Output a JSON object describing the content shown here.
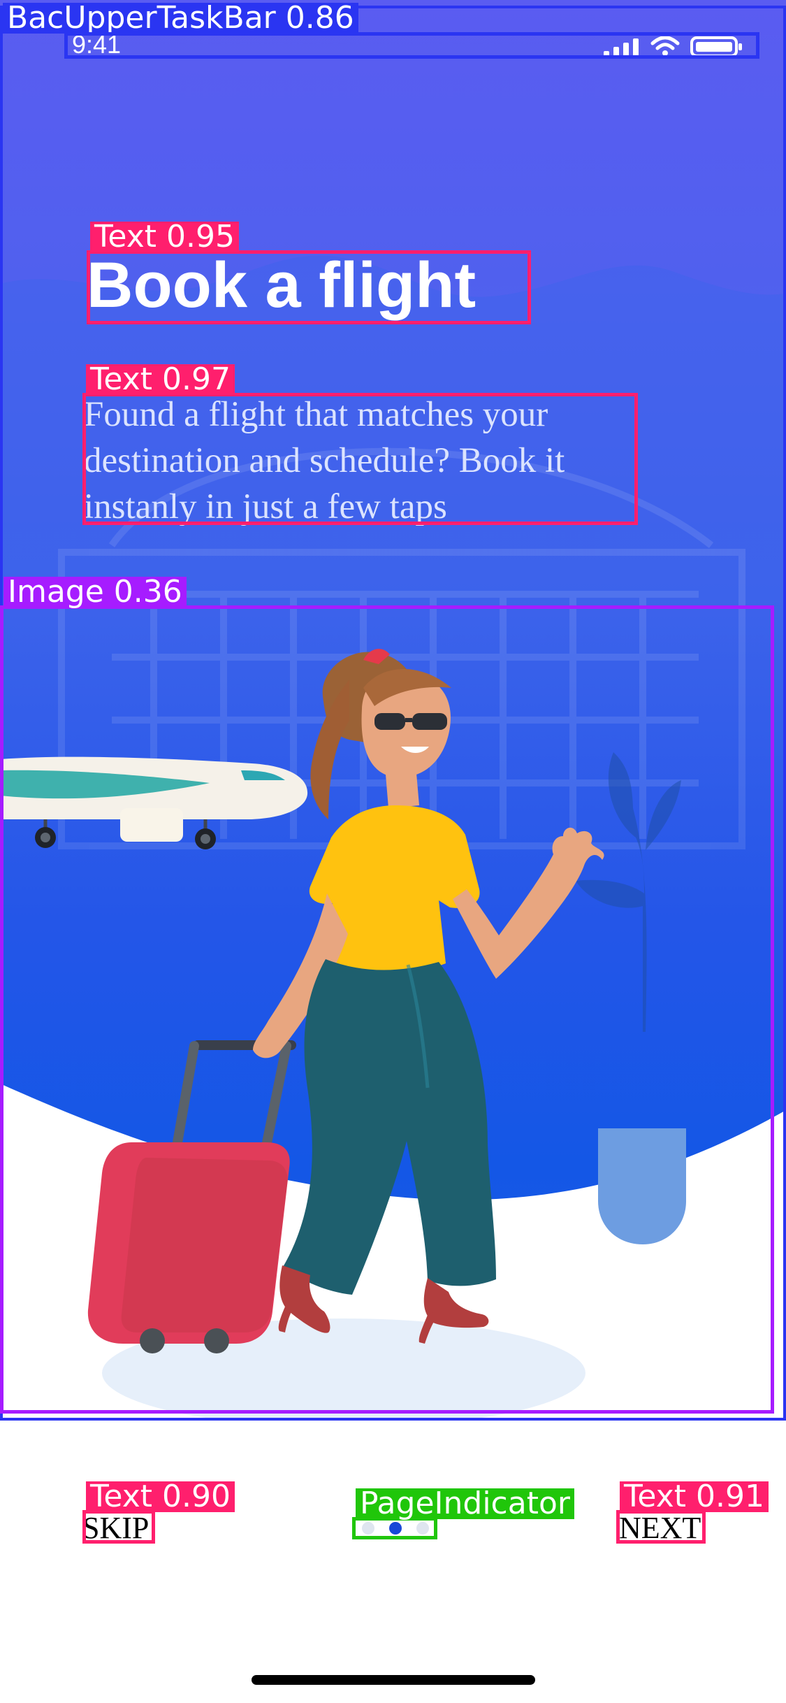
{
  "status_bar": {
    "time": "9:41"
  },
  "onboarding": {
    "title": "Book a flight",
    "description": "Found a flight that matches your destination and schedule? Book it instanly in just a few taps",
    "skip_label": "SKIP",
    "next_label": "NEXT",
    "page_indicator": {
      "total": 3,
      "current": 2
    }
  },
  "annotations": [
    {
      "label": "BacUpperTaskBar 0.86",
      "color": "#2A35F2"
    },
    {
      "label": "Text 0.95",
      "color": "#FF1F6D"
    },
    {
      "label": "Text 0.97",
      "color": "#FF1F6D"
    },
    {
      "label": "Image 0.36",
      "color": "#A61CFF"
    },
    {
      "label": "Text 0.90",
      "color": "#FF1F6D"
    },
    {
      "label": "PageIndicator",
      "color": "#20C60A"
    },
    {
      "label": "Text 0.91",
      "color": "#FF1F6D"
    }
  ],
  "colors": {
    "hero_top": "#5A5CF1",
    "hero_bottom": "#1457E6",
    "text_box": "#FF1F6D",
    "bar_box": "#2A35F2",
    "image_box": "#A61CFF",
    "indicator_box": "#20C60A",
    "active_dot": "#1848D7"
  }
}
